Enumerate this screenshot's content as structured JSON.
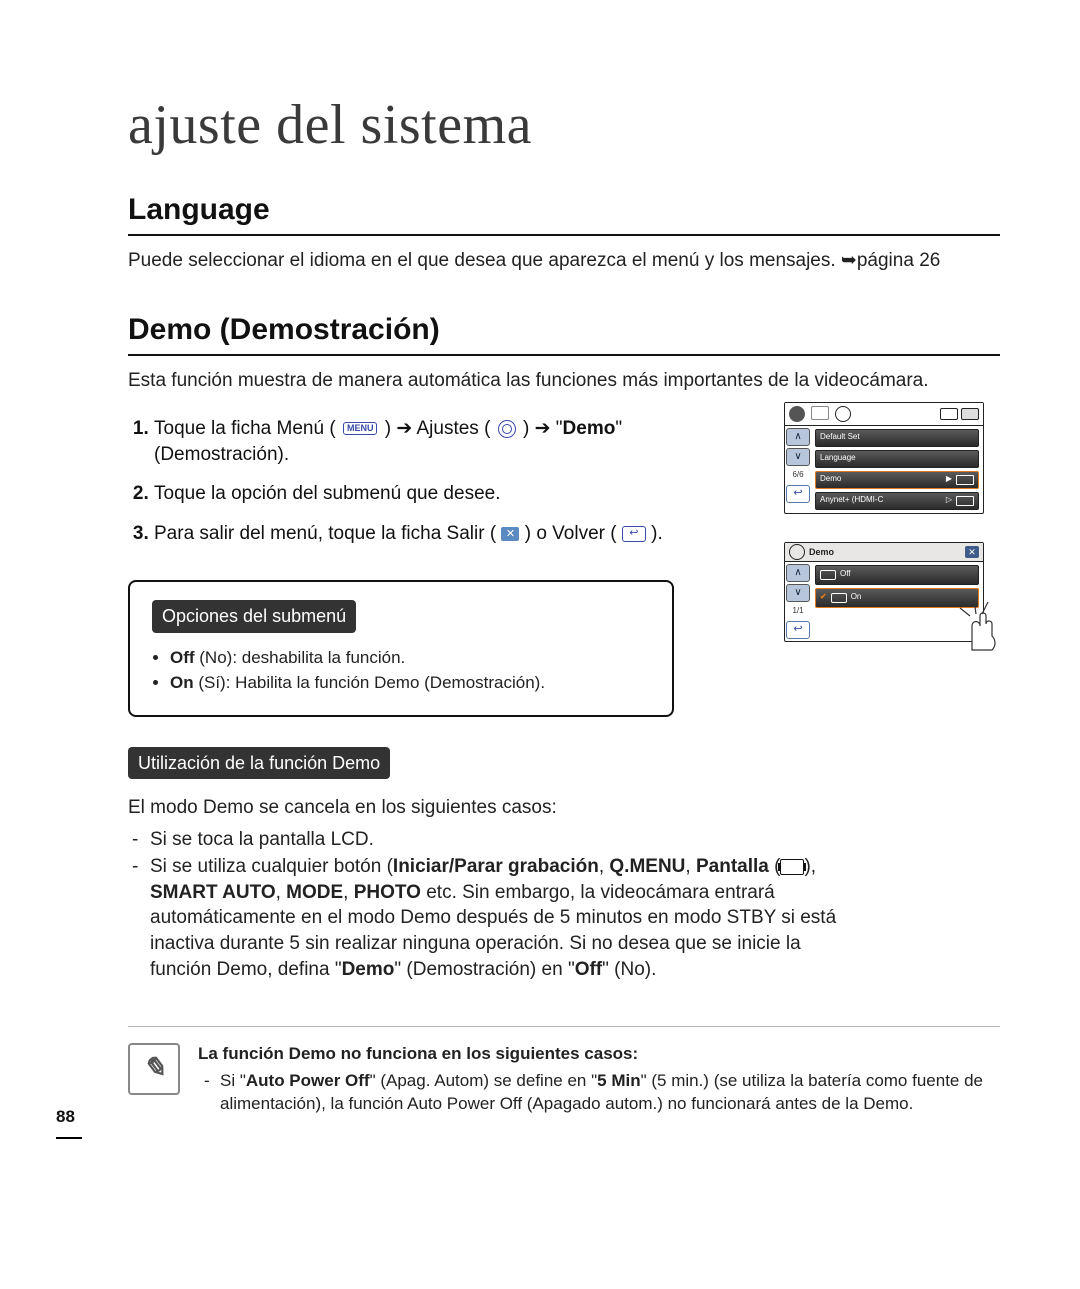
{
  "page_title": "ajuste del sistema",
  "page_number": "88",
  "lang_section": {
    "title": "Language",
    "desc": "Puede seleccionar el idioma en el que desea que aparezca el menú y los mensajes. ➥página 26"
  },
  "demo_section": {
    "title": "Demo (Demostración)",
    "desc": "Esta función muestra de manera automática las funciones más importantes de la videocámara.",
    "step1_pre": "Toque la ficha Menú (",
    "step1_mid1": ") ➔ Ajustes (",
    "step1_mid2": ") ➔ \"",
    "step1_bold": "Demo",
    "step1_post": "\" (Demostración).",
    "step2": "Toque la opción del submenú que desee.",
    "step3_pre": "Para salir del menú, toque la ficha Salir (",
    "step3_mid": ") o Volver (",
    "step3_post": ")."
  },
  "submenu": {
    "title": "Opciones del submenú",
    "off_b": "Off",
    "off_rest": " (No): deshabilita la función.",
    "on_b": "On",
    "on_rest": " (Sí): Habilita la función Demo (Demostración)."
  },
  "use": {
    "title": "Utilización de la función Demo",
    "intro": "El modo Demo se cancela en los siguientes casos:",
    "d1": "Si se toca la pantalla LCD.",
    "d2a": "Si se utiliza cualquier botón (",
    "d2b1": "Iniciar/Parar grabación",
    "d2c": ", ",
    "d2b2": "Q.MENU",
    "d2d": ", ",
    "d2b3": "Pantalla",
    "d2e": " (",
    "d2f": "), ",
    "d2b4": "SMART AUTO",
    "d2g": ", ",
    "d2b5": "MODE",
    "d2h": ", ",
    "d2b6": "PHOTO",
    "d2tail": " etc. Sin embargo, la videocámara entrará automáticamente en el modo Demo después de 5 minutos en modo STBY si está inactiva durante 5 sin realizar ninguna operación. Si no desea que se inicie la función Demo, defina \"",
    "d2demo": "Demo",
    "d2mid2": "\" (Demostración) en \"",
    "d2off": "Off",
    "d2end": "\" (No)."
  },
  "note": {
    "bold_line": "La función Demo no funciona en los siguientes casos:",
    "text1": "Si \"",
    "b1": "Auto Power Off",
    "text2": "\" (Apag. Autom) se define en \"",
    "b2": "5 Min",
    "text3": "\" (5 min.) (se utiliza la batería como fuente de alimentación), la función Auto Power Off (Apagado autom.) no funcionará antes de la Demo."
  },
  "screen1": {
    "page": "6/6",
    "items": [
      "Default Set",
      "Language",
      "Demo",
      "Anynet+ (HDMI-C"
    ]
  },
  "screen2": {
    "title": "Demo",
    "page": "1/1",
    "off": "Off",
    "on": "On"
  },
  "icons": {
    "menu": "MENU",
    "exit": "✕",
    "back": "↩",
    "note": "✎"
  }
}
